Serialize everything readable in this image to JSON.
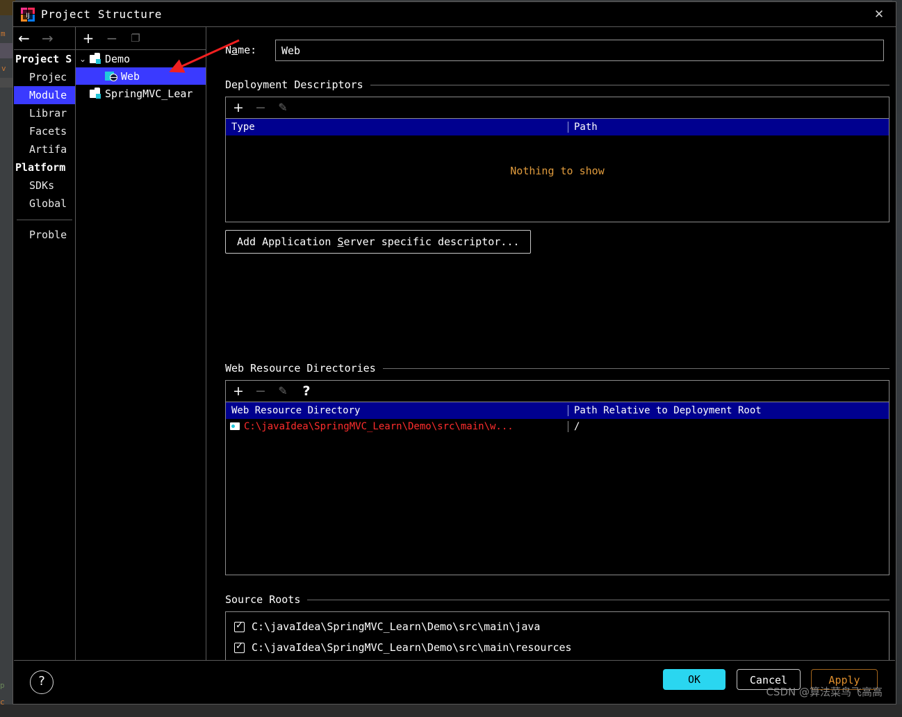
{
  "window": {
    "title": "Project Structure",
    "app_icon": "intellij-idea-icon",
    "close_label": "✕"
  },
  "nav_toolbar": {
    "back_icon": "←",
    "forward_icon": "→"
  },
  "sidebar": {
    "groups": [
      {
        "label": "Project S",
        "items": [
          {
            "label": "Projec",
            "selected": false
          },
          {
            "label": "Module",
            "selected": true
          },
          {
            "label": "Librar",
            "selected": false
          },
          {
            "label": "Facets",
            "selected": false
          },
          {
            "label": "Artifa",
            "selected": false
          }
        ]
      },
      {
        "label": "Platform",
        "items": [
          {
            "label": "SDKs",
            "selected": false
          },
          {
            "label": "Global",
            "selected": false
          }
        ]
      }
    ],
    "footer_items": [
      {
        "label": "Proble",
        "selected": false
      }
    ]
  },
  "tree": {
    "toolbar": {
      "add_icon": "+",
      "remove_icon": "−",
      "copy_icon": "❐"
    },
    "nodes": [
      {
        "label": "Demo",
        "icon": "folder-module-icon",
        "depth": 0,
        "expanded": true,
        "selected": false
      },
      {
        "label": "Web",
        "icon": "web-module-icon",
        "depth": 1,
        "expanded": false,
        "selected": true
      },
      {
        "label": "SpringMVC_Lear",
        "icon": "folder-module-icon",
        "depth": 0,
        "expanded": false,
        "selected": false
      }
    ]
  },
  "name_field": {
    "label": "Name:",
    "label_mnemonic": "a",
    "value": "Web"
  },
  "deployment_descriptors": {
    "title": "Deployment Descriptors",
    "toolbar": {
      "add_icon": "+",
      "remove_icon": "−",
      "edit_icon": "✎"
    },
    "columns": [
      "Type",
      "Path"
    ],
    "rows": [],
    "empty_message": "Nothing to show",
    "add_button_label": "Add Application Server specific descriptor...",
    "add_button_mnemonic": "S"
  },
  "web_resource_directories": {
    "title": "Web Resource Directories",
    "toolbar": {
      "add_icon": "+",
      "remove_icon": "−",
      "edit_icon": "✎",
      "help_icon": "?"
    },
    "columns": [
      "Web Resource Directory",
      "Path Relative to Deployment Root"
    ],
    "rows": [
      {
        "directory": "C:\\javaIdea\\SpringMVC_Learn\\Demo\\src\\main\\w...",
        "relative_path": "/",
        "icon": "resource-dir-icon"
      }
    ]
  },
  "source_roots": {
    "title": "Source Roots",
    "items": [
      {
        "label": "C:\\javaIdea\\SpringMVC_Learn\\Demo\\src\\main\\java",
        "checked": true
      },
      {
        "label": "C:\\javaIdea\\SpringMVC_Learn\\Demo\\src\\main\\resources",
        "checked": true
      }
    ]
  },
  "footer": {
    "help_icon": "?",
    "ok_label": "OK",
    "cancel_label": "Cancel",
    "apply_label": "Apply"
  },
  "annotation": {
    "arrow_color": "#f02020",
    "arrow_from": "Name label area",
    "arrow_to": "Web tree node"
  },
  "watermark": "CSDN @算法菜鸟飞高高",
  "colors": {
    "selection_blue": "#3a3aff",
    "table_header_blue": "#00008f",
    "accent_cyan": "#2ad6f0",
    "apply_orange": "#e08f2d",
    "empty_text_orange": "#e09b3d",
    "path_red": "#ff2d2d",
    "dialog_bg": "#000000"
  }
}
